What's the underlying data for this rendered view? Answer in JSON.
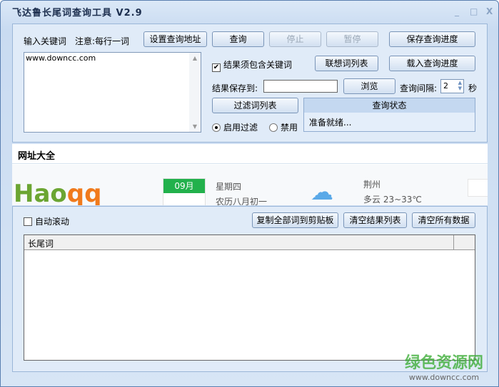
{
  "window": {
    "title": "飞达鲁长尾词查询工具  V2.9",
    "minimize": "_",
    "maximize": "□",
    "close": "X"
  },
  "top": {
    "keyword_label": "输入关键词",
    "note": "注意:每行一词",
    "set_url_button": "设置查询地址",
    "query_button": "查询",
    "stop_button": "停止",
    "pause_button": "暂停",
    "save_progress_button": "保存查询进度",
    "load_progress_button": "载入查询进度",
    "keywords_value": "www.downcc.com",
    "must_contain_label": "结果须包含关键词",
    "must_contain_checked": true,
    "related_list_button": "联想词列表",
    "save_to_label": "结果保存到:",
    "save_to_value": "",
    "browse_button": "浏览",
    "interval_label": "查询间隔:",
    "interval_value": "2",
    "interval_unit": "秒",
    "filter_list_button": "过滤词列表",
    "filter_on_label": "启用过滤",
    "filter_off_label": "禁用",
    "filter_enabled": true,
    "status_header": "查询状态",
    "status_text": "准备就绪..."
  },
  "web": {
    "tab_title": "网址大全",
    "logo": "Hao qq",
    "month": "09月",
    "weekday": "星期四",
    "lunar": "农历八月初一",
    "city": "荆州",
    "weather": "多云 23~33℃"
  },
  "bottom": {
    "auto_scroll_label": "自动滚动",
    "auto_scroll_checked": false,
    "copy_all_button": "复制全部词到剪贴板",
    "clear_results_button": "清空结果列表",
    "clear_all_button": "清空所有数据",
    "column_header": "长尾词"
  },
  "watermark": {
    "text": "绿色资源网",
    "url": "www.downcc.com"
  }
}
